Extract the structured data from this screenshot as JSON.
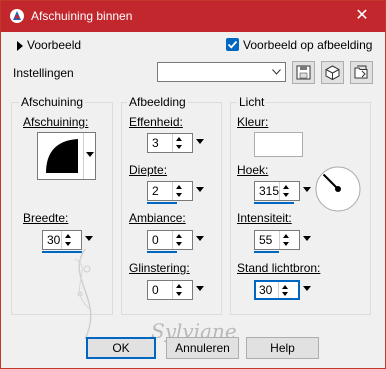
{
  "window": {
    "title": "Afschuining binnen",
    "close_glyph": "✕"
  },
  "preview": {
    "label": "Voorbeeld",
    "on_image_label": "Voorbeeld op afbeelding",
    "on_image_checked": true
  },
  "settings": {
    "label": "Instellingen",
    "value": ""
  },
  "groups": {
    "bevel": {
      "title": "Afschuining",
      "shape_label": "Afschuining:",
      "width_label": "Breedte:",
      "width_value": "30"
    },
    "image": {
      "title": "Afbeelding",
      "smoothness_label": "Effenheid:",
      "smoothness_value": "3",
      "depth_label": "Diepte:",
      "depth_value": "2",
      "ambience_label": "Ambiance:",
      "ambience_value": "0",
      "shininess_label": "Glinstering:",
      "shininess_value": "0"
    },
    "light": {
      "title": "Licht",
      "color_label": "Kleur:",
      "color_value": "#ffffff",
      "angle_label": "Hoek:",
      "angle_value": "315",
      "intensity_label": "Intensiteit:",
      "intensity_value": "55",
      "elevation_label": "Stand lichtbron:",
      "elevation_value": "30"
    }
  },
  "buttons": {
    "ok": "OK",
    "cancel": "Annuleren",
    "help": "Help"
  },
  "watermark": "Sylviane",
  "colors": {
    "accent": "#0067c0",
    "titlebar": "#c2272d"
  }
}
